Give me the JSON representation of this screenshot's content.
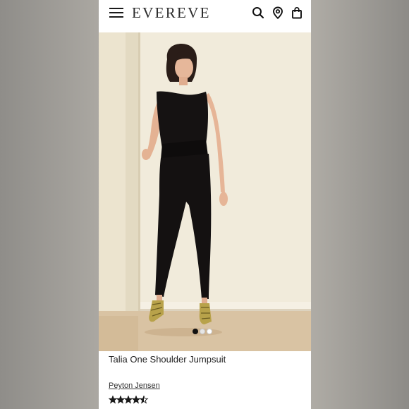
{
  "header": {
    "logo": "EVEREVE",
    "icons": [
      "hamburger-menu-icon",
      "search-icon",
      "location-pin-icon",
      "shopping-bag-icon"
    ]
  },
  "carousel": {
    "slide_count": 3,
    "active_index": 0
  },
  "product": {
    "title": "Talia One Shoulder Jumpsuit",
    "designer": "Peyton Jensen",
    "rating": 4.5,
    "rating_max": 5
  },
  "colors": {
    "text": "#222222",
    "star": "#1a1a1a",
    "photo_background": "#f0ead9"
  }
}
